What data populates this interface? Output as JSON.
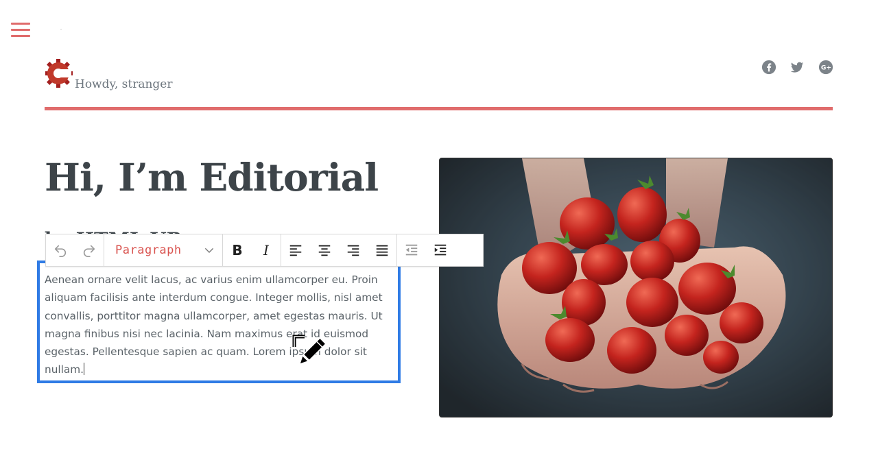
{
  "header": {
    "tagline": "Howdy, stranger",
    "logo_icon": "gear-c-logo",
    "social": [
      "facebook-icon",
      "twitter-icon",
      "google-plus-icon"
    ]
  },
  "hero": {
    "title": "Hi, I’m Editorial",
    "subtitle_partial": "by HTML UP",
    "image_subject": "hands-holding-strawberries"
  },
  "toolbar": {
    "undo_icon": "undo-icon",
    "redo_icon": "redo-icon",
    "format_value": "Paragraph",
    "bold_label": "B",
    "italic_label": "I"
  },
  "editor": {
    "text": "Aenean ornare velit lacus, ac varius enim ullamcorper eu. Proin\naliquam facilisis ante interdum congue. Integer mollis, nisl amet\nconvallis, porttitor magna ullamcorper, amet egestas mauris. Ut\nmagna finibus nisi nec lacinia. Nam maximus erat id euismod\negestas. Pellentesque sapien ac quam. Lorem ipsum dolor sit\nnullam."
  },
  "colors": {
    "accent": "#e06c6c",
    "editor_border": "#2f7be5",
    "format_label": "#d9534f",
    "text": "#3d4449"
  }
}
